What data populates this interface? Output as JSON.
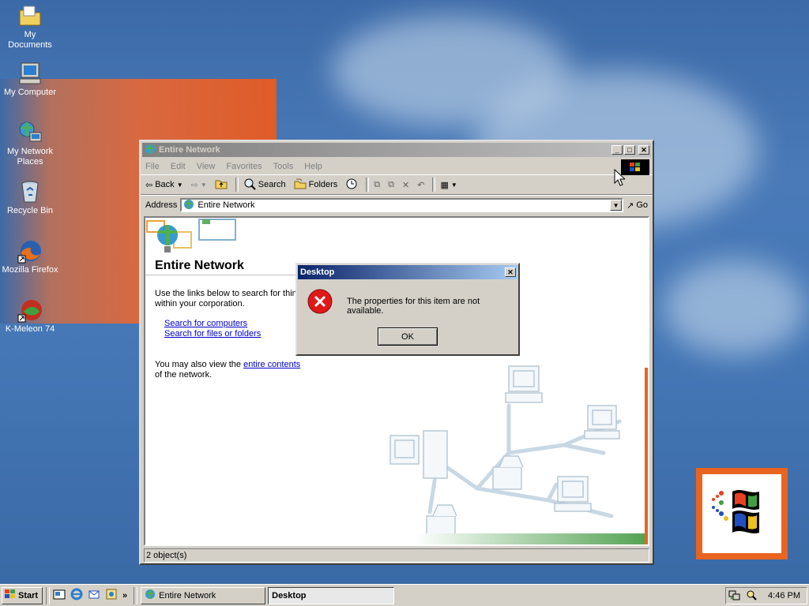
{
  "desktop": {
    "icons": [
      {
        "label": "My Documents",
        "icon": "folder-documents-icon"
      },
      {
        "label": "My Computer",
        "icon": "computer-icon"
      },
      {
        "label": "My Network Places",
        "icon": "network-places-icon"
      },
      {
        "label": "Recycle Bin",
        "icon": "recycle-bin-icon"
      },
      {
        "label": "Mozilla Firefox",
        "icon": "firefox-icon"
      },
      {
        "label": "K-Meleon 74",
        "icon": "k-meleon-icon"
      }
    ]
  },
  "explorer": {
    "title": "Entire Network",
    "menu": [
      "File",
      "Edit",
      "View",
      "Favorites",
      "Tools",
      "Help"
    ],
    "toolbar": {
      "back": "Back",
      "search": "Search",
      "folders": "Folders"
    },
    "address": {
      "label": "Address",
      "value": "Entire Network",
      "go": "Go"
    },
    "content": {
      "heading": "Entire Network",
      "intro_line1": "Use the links below to search for thing",
      "intro_line2": "within your corporation.",
      "link_computers": "Search for computers",
      "link_files": "Search for files or folders",
      "view_prefix": "You may also view the ",
      "view_link": "entire contents",
      "view_suffix": "of the network."
    },
    "status": "2 object(s)"
  },
  "dialog": {
    "title": "Desktop",
    "message": "The properties for this item are not available.",
    "ok": "OK"
  },
  "taskbar": {
    "start": "Start",
    "tasks": [
      {
        "label": "Entire Network",
        "active": false
      },
      {
        "label": "Desktop",
        "active": true
      }
    ],
    "quicklaunch_more": "»",
    "clock": "4:46 PM"
  },
  "colors": {
    "desktop_blue": "#4577b6",
    "titlebar_active": "#0a246a",
    "titlebar_inactive": "#808080",
    "accent_orange": "#e86420"
  }
}
